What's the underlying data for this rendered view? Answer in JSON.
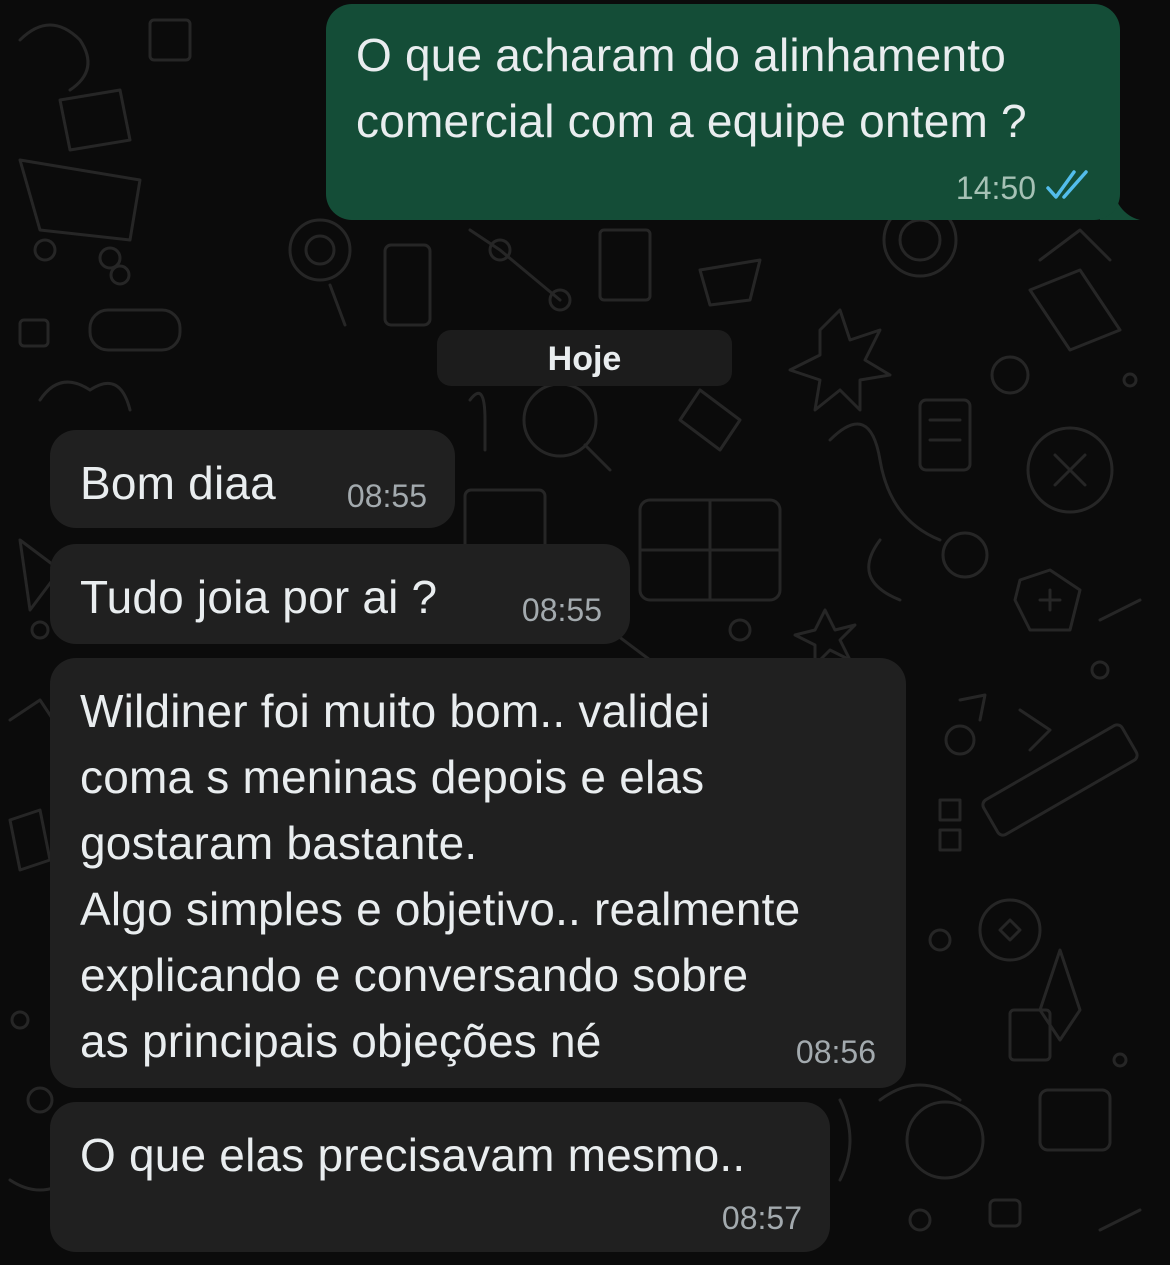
{
  "chat": {
    "date_separator": "Hoje",
    "messages": [
      {
        "direction": "outgoing",
        "text": "O que acharam do alinhamento\ncomercial com a equipe ontem ?",
        "time": "14:50",
        "status": "read",
        "status_icon": "double-check-icon"
      },
      {
        "direction": "incoming",
        "text": "Bom diaa",
        "time": "08:55"
      },
      {
        "direction": "incoming",
        "text": "Tudo joia por ai ?",
        "time": "08:55"
      },
      {
        "direction": "incoming",
        "text": "Wildiner foi muito bom.. validei\ncoma s meninas depois e elas\ngostaram bastante.\nAlgo simples e objetivo.. realmente\nexplicando e conversando sobre\nas principais objeções né",
        "time": "08:56"
      },
      {
        "direction": "incoming",
        "text": "O que elas precisavam mesmo..",
        "time": "08:57"
      }
    ]
  },
  "colors": {
    "background": "#0b0b0b",
    "incoming_bubble": "#202020",
    "outgoing_bubble": "#144d37",
    "read_tick": "#53bdeb",
    "doodle": "#262626"
  }
}
